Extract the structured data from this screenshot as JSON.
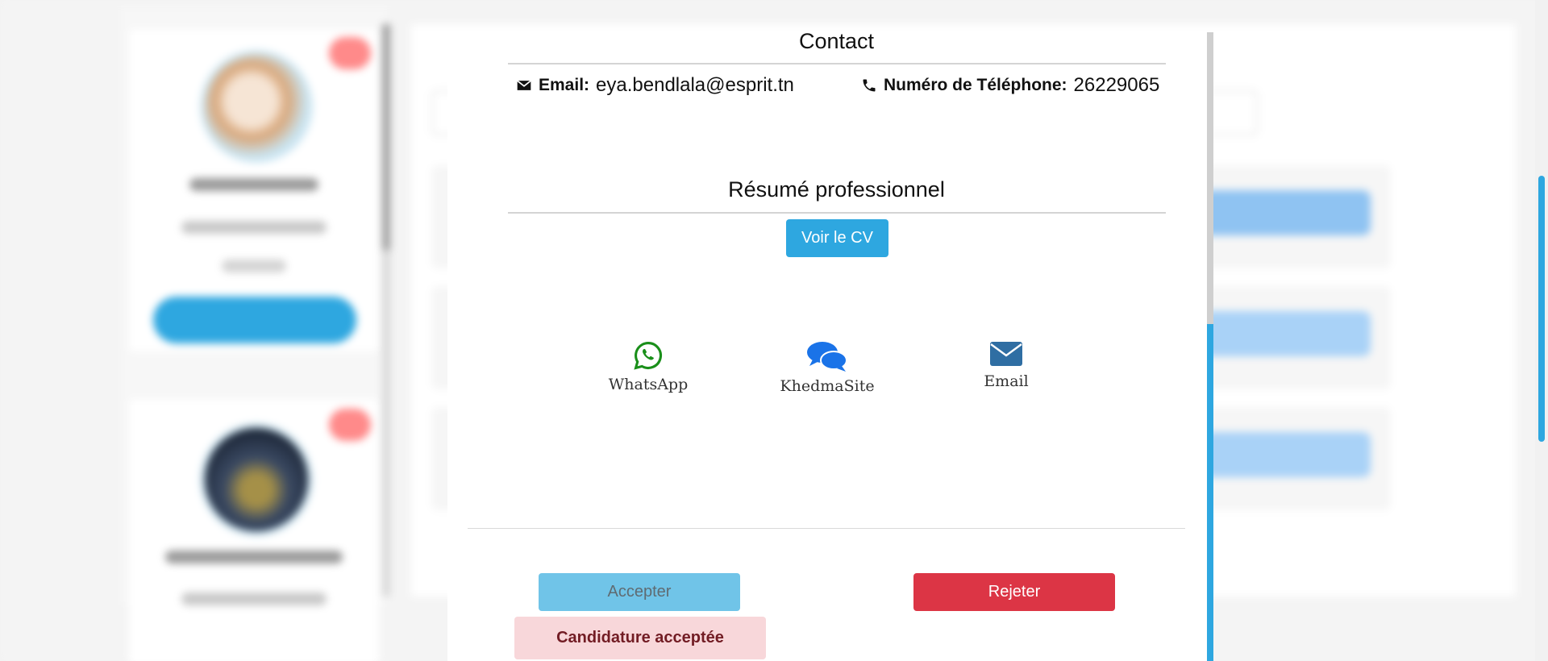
{
  "modal": {
    "contact": {
      "title": "Contact",
      "email_label": "Email:",
      "email_value": "eya.bendlala@esprit.tn",
      "phone_label": "Numéro de Téléphone:",
      "phone_value": "26229065"
    },
    "resume": {
      "title": "Résumé professionnel",
      "cv_button": "Voir le CV"
    },
    "share": [
      {
        "label": "WhatsApp",
        "icon": "whatsapp-icon",
        "color": "#1a8f1a"
      },
      {
        "label": "KhedmaSite",
        "icon": "chat-bubbles-icon",
        "color": "#1a73e8"
      },
      {
        "label": "Email",
        "icon": "envelope-icon",
        "color": "#2f6ea3"
      }
    ],
    "actions": {
      "accept": "Accepter",
      "reject": "Rejeter"
    },
    "status": "Candidature acceptée"
  },
  "colors": {
    "primary": "#2ea7e0",
    "danger": "#dc3545",
    "success_bg": "#f8d7da",
    "status_text": "#721c24"
  }
}
